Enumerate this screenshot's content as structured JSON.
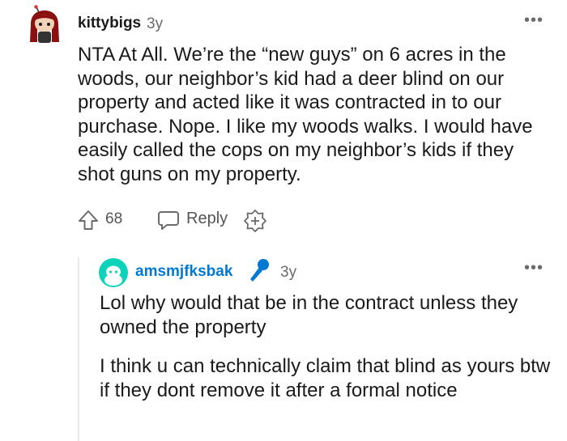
{
  "comment": {
    "username": "kittybigs",
    "age": "3y",
    "more_label": "•••",
    "body": "NTA At All. We’re the “new guys” on 6 acres in the woods, our neighbor’s kid had a deer blind on our property and acted like it was contracted in to our purchase. Nope. I like my woods walks. I would have easily called the cops on my neighbor’s kids if they shot guns on my property.",
    "votes": "68",
    "reply_label": "Reply",
    "icons": [
      "avatar",
      "upvote-icon",
      "reply-icon",
      "award-icon",
      "more-icon"
    ]
  },
  "reply_comment": {
    "username": "amsmjfksbak",
    "age": "3y",
    "more_label": "•••",
    "paragraphs": [
      "Lol why would that be in the contract unless they owned the property",
      "I think u can technically claim that blind as yours btw if they dont remove it after a formal notice"
    ],
    "icons": [
      "avatar",
      "microphone-icon",
      "more-icon"
    ]
  },
  "colors": {
    "text": "#1a1a1b",
    "meta": "#6b6b6b",
    "reply_username": "#0079d3",
    "avatar2_bg": "#0dd3bb",
    "mic": "#0079d3",
    "avatar1_hair": "#8b1010"
  }
}
